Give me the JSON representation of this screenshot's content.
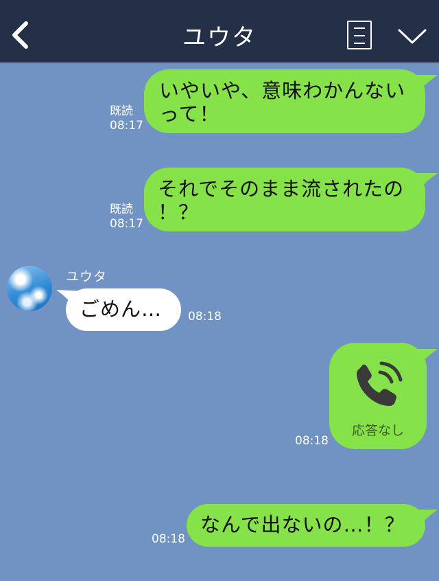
{
  "header": {
    "back_icon": "chevron-left-icon",
    "title": "ユウタ",
    "menu_icon": "note-list-icon",
    "collapse_icon": "chevron-down-icon"
  },
  "colors": {
    "header_bg": "#243048",
    "chat_bg": "#7193c3",
    "sent_bubble": "#85e249",
    "received_bubble": "#ffffff"
  },
  "messages": [
    {
      "direction": "sent",
      "text_line1": "いやいや、意味わかんない",
      "text_line2": "って！",
      "read": "既読",
      "time": "08:17"
    },
    {
      "direction": "sent",
      "text_line1": "それでそのまま流されたの",
      "text_line2": "！？",
      "read": "既読",
      "time": "08:17"
    },
    {
      "direction": "received",
      "sender": "ユウタ",
      "text": "ごめん…",
      "time": "08:18"
    },
    {
      "direction": "sent",
      "type": "call",
      "call_icon": "phone-call-icon",
      "call_status": "応答なし",
      "time": "08:18"
    },
    {
      "direction": "sent",
      "text": "なんで出ないの…！？",
      "time": "08:18"
    }
  ]
}
